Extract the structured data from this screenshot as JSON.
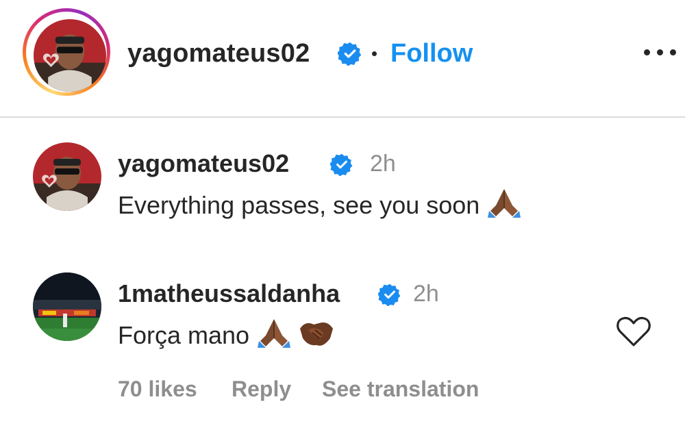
{
  "header": {
    "username": "yagomateus02",
    "separator": "•",
    "follow_label": "Follow",
    "more_icon": "more-horizontal-icon",
    "verified_icon": "verified-badge-icon"
  },
  "comments": [
    {
      "username": "yagomateus02",
      "time": "2h",
      "text": "Everything passes, see you soon",
      "emojis": [
        "folded-hands-emoji"
      ]
    },
    {
      "username": "1matheussaldanha",
      "time": "2h",
      "text": "Força mano",
      "emojis": [
        "folded-hands-emoji",
        "handshake-emoji"
      ],
      "likes": "70 likes",
      "reply_label": "Reply",
      "translate_label": "See translation",
      "like_icon": "heart-outline-icon"
    }
  ],
  "colors": {
    "follow_blue": "#1591f0",
    "verified_blue": "#1a8cf0",
    "text": "#262626",
    "muted": "#8e8e8e",
    "divider": "#dbdbdb"
  }
}
